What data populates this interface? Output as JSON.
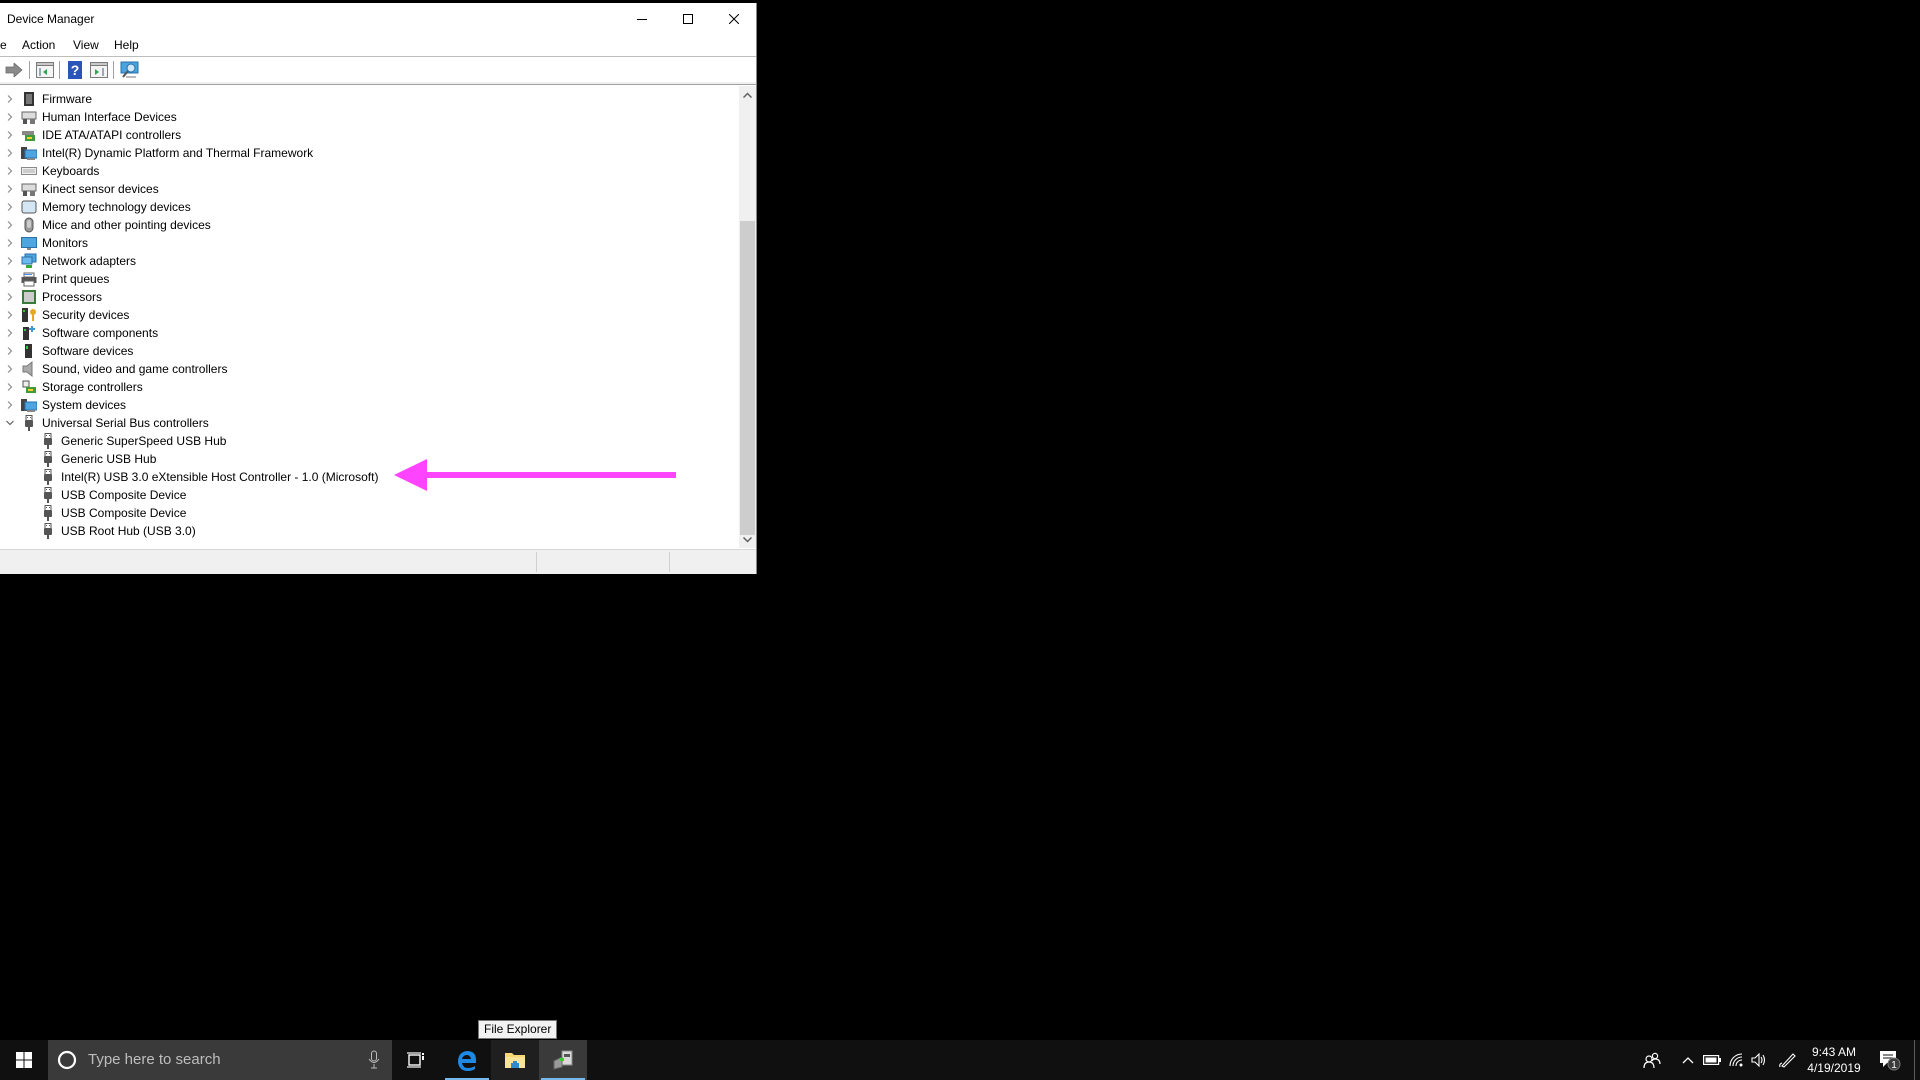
{
  "window": {
    "title": "Device Manager",
    "controls": {
      "minimize": "minimize",
      "maximize": "maximize",
      "close": "close"
    }
  },
  "menu": {
    "items": [
      {
        "label": "e",
        "full": "File"
      },
      {
        "label": "Action"
      },
      {
        "label": "View"
      },
      {
        "label": "Help"
      }
    ]
  },
  "toolbar": {
    "buttons": [
      {
        "icon": "forward-arrow-icon",
        "tooltip": "Forward"
      },
      {
        "icon": "properties-icon",
        "tooltip": "Properties"
      },
      {
        "icon": "help-icon",
        "tooltip": "Help"
      },
      {
        "icon": "update-driver-icon",
        "tooltip": "Update driver"
      },
      {
        "icon": "scan-hardware-icon",
        "tooltip": "Scan for hardware changes"
      }
    ]
  },
  "tree": {
    "categories": [
      {
        "label": "Firmware",
        "icon": "firmware-chip-icon",
        "expanded": false
      },
      {
        "label": "Human Interface Devices",
        "icon": "hid-icon",
        "expanded": false
      },
      {
        "label": "IDE ATA/ATAPI controllers",
        "icon": "ide-controller-icon",
        "expanded": false
      },
      {
        "label": "Intel(R) Dynamic Platform and Thermal Framework",
        "icon": "system-device-icon",
        "expanded": false
      },
      {
        "label": "Keyboards",
        "icon": "keyboard-icon",
        "expanded": false
      },
      {
        "label": "Kinect sensor devices",
        "icon": "hid-icon",
        "expanded": false
      },
      {
        "label": "Memory technology devices",
        "icon": "memory-device-icon",
        "expanded": false
      },
      {
        "label": "Mice and other pointing devices",
        "icon": "mouse-icon",
        "expanded": false
      },
      {
        "label": "Monitors",
        "icon": "monitor-icon",
        "expanded": false
      },
      {
        "label": "Network adapters",
        "icon": "network-adapter-icon",
        "expanded": false
      },
      {
        "label": "Print queues",
        "icon": "printer-icon",
        "expanded": false
      },
      {
        "label": "Processors",
        "icon": "processor-icon",
        "expanded": false
      },
      {
        "label": "Security devices",
        "icon": "security-device-icon",
        "expanded": false
      },
      {
        "label": "Software components",
        "icon": "software-component-icon",
        "expanded": false
      },
      {
        "label": "Software devices",
        "icon": "software-device-icon",
        "expanded": false
      },
      {
        "label": "Sound, video and game controllers",
        "icon": "speaker-icon",
        "expanded": false
      },
      {
        "label": "Storage controllers",
        "icon": "storage-controller-icon",
        "expanded": false
      },
      {
        "label": "System devices",
        "icon": "system-device-icon",
        "expanded": false
      },
      {
        "label": "Universal Serial Bus controllers",
        "icon": "usb-icon",
        "expanded": true,
        "children": [
          {
            "label": "Generic SuperSpeed USB Hub",
            "icon": "usb-icon"
          },
          {
            "label": "Generic USB Hub",
            "icon": "usb-icon"
          },
          {
            "label": "Intel(R) USB 3.0 eXtensible Host Controller - 1.0 (Microsoft)",
            "icon": "usb-icon",
            "highlighted_by_annotation": true
          },
          {
            "label": "USB Composite Device",
            "icon": "usb-icon"
          },
          {
            "label": "USB Composite Device",
            "icon": "usb-icon"
          },
          {
            "label": "USB Root Hub (USB 3.0)",
            "icon": "usb-icon"
          }
        ]
      }
    ]
  },
  "scrollbar": {
    "position_fraction": 1.0,
    "visible_fraction": 0.7
  },
  "annotation": {
    "type": "arrow",
    "direction": "left",
    "color": "#FF44FF",
    "points_to": "Intel(R) USB 3.0 eXtensible Host Controller - 1.0 (Microsoft)"
  },
  "tooltip": {
    "text": "File Explorer"
  },
  "taskbar": {
    "start_icon": "windows-logo-icon",
    "search_placeholder": "Type here to search",
    "pinned": [
      {
        "name": "Task View",
        "icon": "task-view-icon"
      },
      {
        "name": "Microsoft Edge",
        "icon": "edge-icon",
        "running": true
      },
      {
        "name": "File Explorer",
        "icon": "folder-icon",
        "running": false,
        "hovered": true
      },
      {
        "name": "Device Manager",
        "icon": "device-manager-icon",
        "running": true,
        "active": true
      }
    ],
    "tray": {
      "icons": [
        "people-icon",
        "chevron-up-icon",
        "battery-icon",
        "wifi-icon",
        "volume-icon",
        "pen-icon"
      ],
      "time": "9:43 AM",
      "date": "4/19/2019",
      "notification_count": "1"
    }
  },
  "colors": {
    "accent": "#0078D7",
    "taskbar_bg": "#101010",
    "annotation": "#FF44FF",
    "running_indicator": "#76B9ED"
  }
}
